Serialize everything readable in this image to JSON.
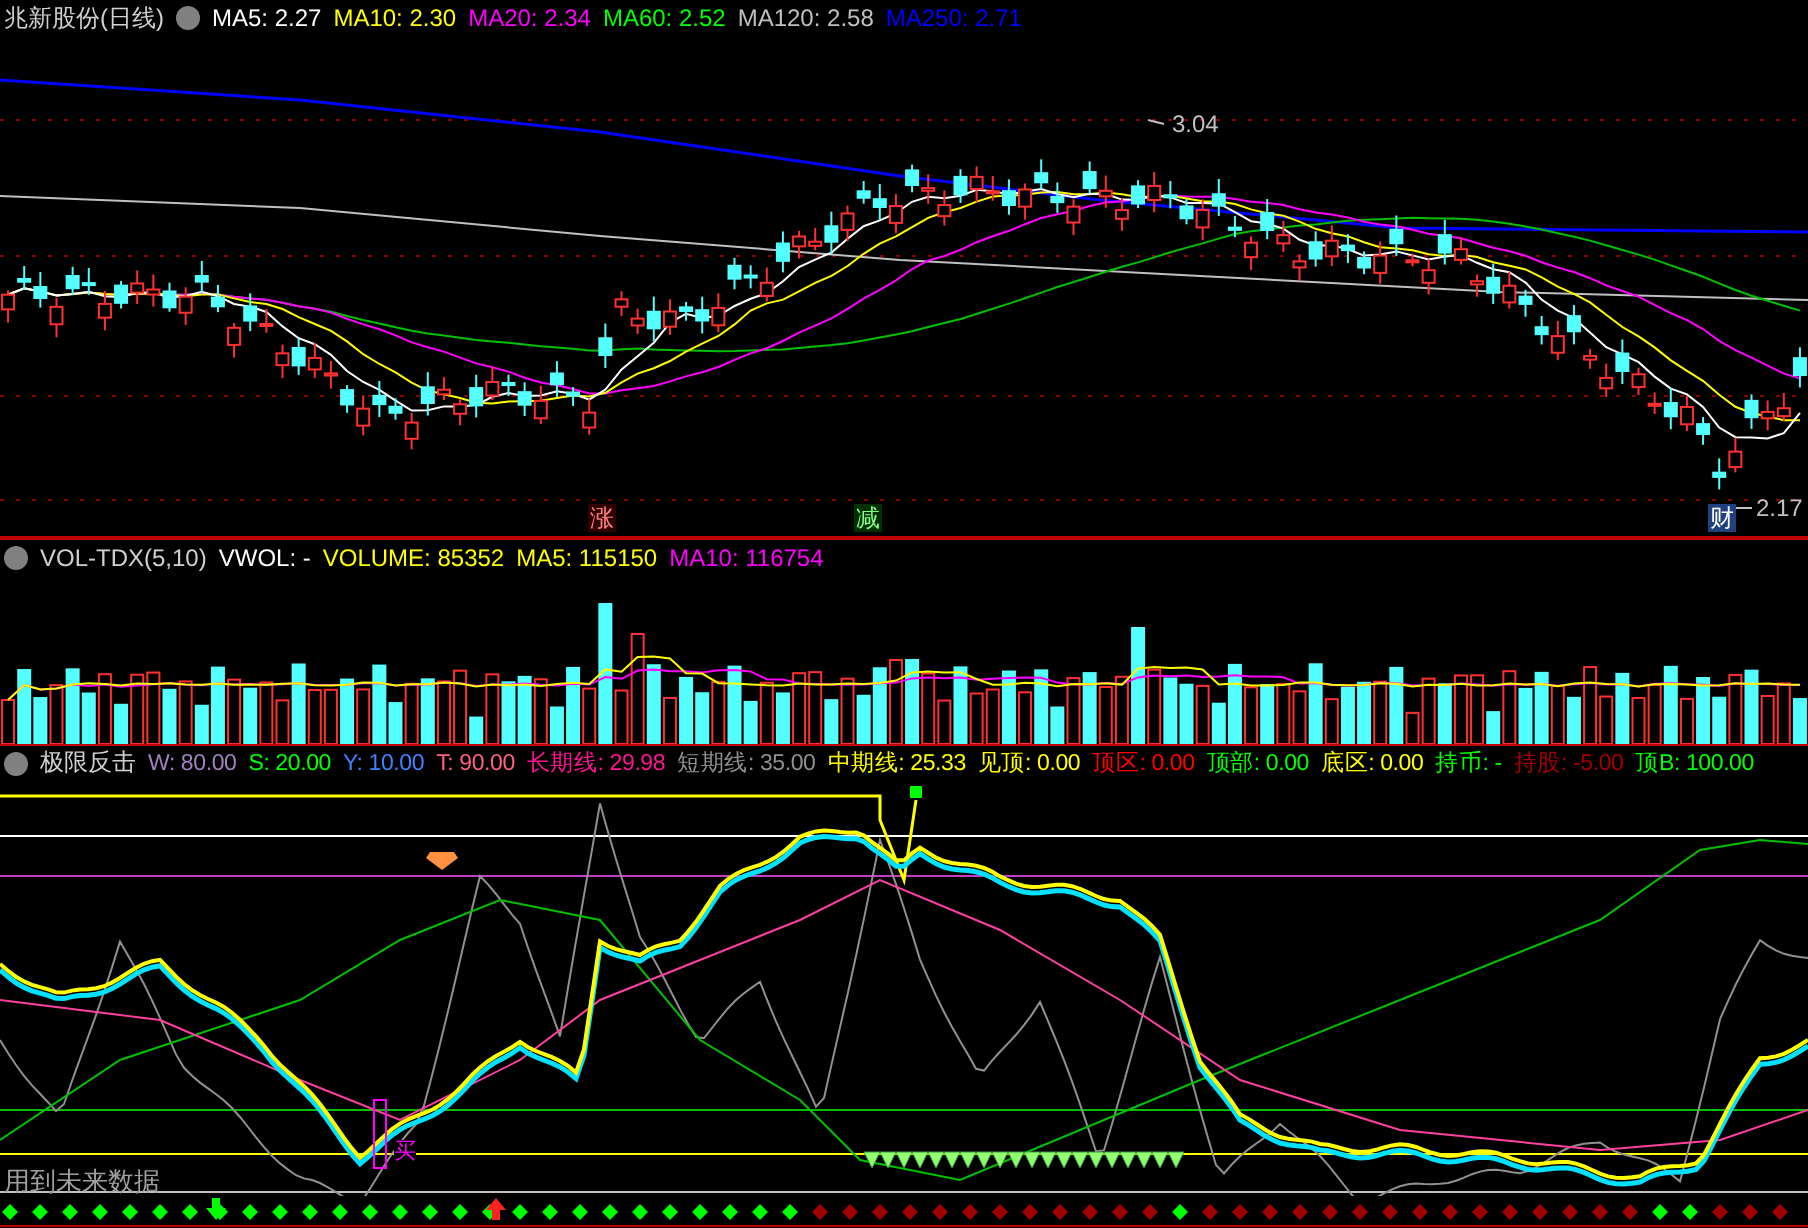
{
  "price_panel": {
    "title": "兆新股份(日线)",
    "indicators": [
      {
        "text": "MA5: 2.27",
        "color": "#ffffff"
      },
      {
        "text": "MA10: 2.30",
        "color": "#ffff00"
      },
      {
        "text": "MA20: 2.34",
        "color": "#ff00ff"
      },
      {
        "text": "MA60: 2.52",
        "color": "#00ff00"
      },
      {
        "text": "MA120: 2.58",
        "color": "#c0c0c0"
      },
      {
        "text": "MA250: 2.71",
        "color": "#0000ff"
      }
    ],
    "high_label": "3.04",
    "low_label": "2.17",
    "markers": [
      {
        "text": "涨",
        "kind": "rise"
      },
      {
        "text": "减",
        "kind": "reduce"
      },
      {
        "text": "财",
        "kind": "finance"
      }
    ]
  },
  "volume_panel": {
    "title": "VOL-TDX(5,10)",
    "indicators": [
      {
        "text": "VWOL: -",
        "color": "#ffffff"
      },
      {
        "text": "VOLUME: 85352",
        "color": "#ffff00"
      },
      {
        "text": "MA5: 115150",
        "color": "#ffff00"
      },
      {
        "text": "MA10: 116754",
        "color": "#ff00ff"
      }
    ]
  },
  "signal_panel": {
    "title": "极限反击",
    "indicators": [
      {
        "text": "W: 80.00",
        "color": "#a080c0"
      },
      {
        "text": "S: 20.00",
        "color": "#00ff00"
      },
      {
        "text": "Y: 10.00",
        "color": "#4080ff"
      },
      {
        "text": "T: 90.00",
        "color": "#ff6080"
      },
      {
        "text": "长期线: 29.98",
        "color": "#ff1493"
      },
      {
        "text": "短期线: 35.00",
        "color": "#909090"
      },
      {
        "text": "中期线: 25.33",
        "color": "#ffff00"
      },
      {
        "text": "见顶: 0.00",
        "color": "#ffff00"
      },
      {
        "text": "顶区: 0.00",
        "color": "#ff0000"
      },
      {
        "text": "顶部: 0.00",
        "color": "#00ff00"
      },
      {
        "text": "底区: 0.00",
        "color": "#ffff00"
      },
      {
        "text": "持币: -",
        "color": "#00ff00"
      },
      {
        "text": "持股: -5.00",
        "color": "#a00000"
      },
      {
        "text": "顶B: 100.00",
        "color": "#00ff00"
      }
    ],
    "buy_label": "买",
    "warning": "用到未来数据"
  }
}
